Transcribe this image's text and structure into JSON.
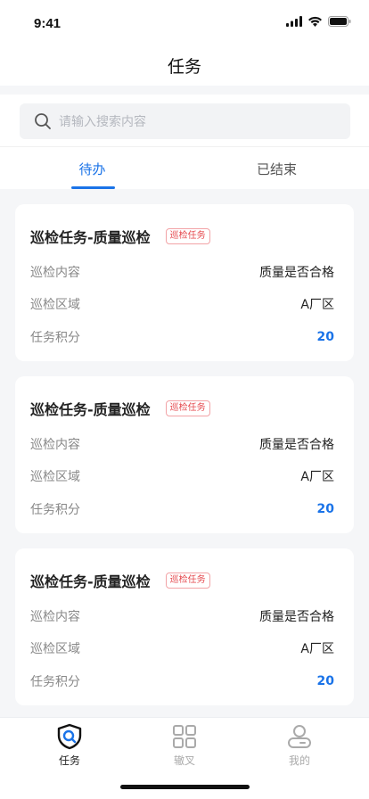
{
  "status_bar": {
    "time": "9:41"
  },
  "nav": {
    "title": "任务"
  },
  "search": {
    "placeholder": "请输入搜索内容"
  },
  "tabs": [
    {
      "label": "待办",
      "active": true
    },
    {
      "label": "已结束",
      "active": false
    }
  ],
  "cards": [
    {
      "title": "巡检任务-质量巡检",
      "tag": "巡检任务",
      "rows": [
        {
          "label": "巡检内容",
          "value": "质量是否合格"
        },
        {
          "label": "巡检区域",
          "value": "A厂区"
        },
        {
          "label": "任务积分",
          "value": "20"
        }
      ]
    },
    {
      "title": "巡检任务-质量巡检",
      "tag": "巡检任务",
      "rows": [
        {
          "label": "巡检内容",
          "value": "质量是否合格"
        },
        {
          "label": "巡检区域",
          "value": "A厂区"
        },
        {
          "label": "任务积分",
          "value": "20"
        }
      ]
    },
    {
      "title": "巡检任务-质量巡检",
      "tag": "巡检任务",
      "rows": [
        {
          "label": "巡检内容",
          "value": "质量是否合格"
        },
        {
          "label": "巡检区域",
          "value": "A厂区"
        },
        {
          "label": "任务积分",
          "value": "20"
        }
      ]
    }
  ],
  "tabbar": [
    {
      "label": "任务",
      "icon": "task-shield-icon",
      "active": true
    },
    {
      "label": "辙叉",
      "icon": "grid-icon",
      "active": false
    },
    {
      "label": "我的",
      "icon": "user-icon",
      "active": false
    }
  ],
  "colors": {
    "accent": "#1a73e8",
    "tag": "#e5484d"
  }
}
